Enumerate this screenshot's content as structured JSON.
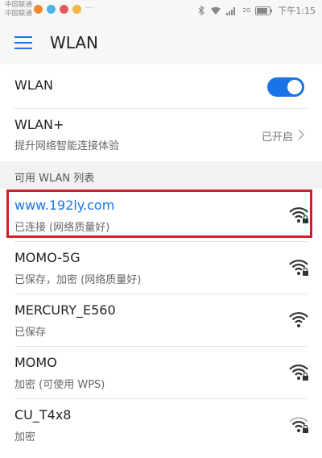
{
  "status_bar": {
    "carrier_1": "中国联通",
    "carrier_2": "中国联通",
    "more": "···",
    "signal_label": "2G",
    "time": "下午1:15"
  },
  "header": {
    "title": "WLAN"
  },
  "wlan_toggle": {
    "label": "WLAN",
    "state": "on"
  },
  "wlan_plus": {
    "label": "WLAN+",
    "subtitle": "提升网络智能连接体验",
    "status": "已开启"
  },
  "section": {
    "title": "可用 WLAN 列表"
  },
  "networks": [
    {
      "ssid": "www.192ly.com",
      "status": "已连接 (网络质量好)",
      "secured": true,
      "connected": true,
      "strength": 4
    },
    {
      "ssid": "MOMO-5G",
      "status": "已保存，加密 (网络质量好)",
      "secured": true,
      "connected": false,
      "strength": 4
    },
    {
      "ssid": "MERCURY_E560",
      "status": "已保存",
      "secured": false,
      "connected": false,
      "strength": 4
    },
    {
      "ssid": "MOMO",
      "status": "加密 (可使用 WPS)",
      "secured": true,
      "connected": false,
      "strength": 4
    },
    {
      "ssid": "CU_T4x8",
      "status": "加密",
      "secured": true,
      "connected": false,
      "strength": 3
    }
  ],
  "colors": {
    "accent": "#1a73e8",
    "highlight_border": "#d11f2a"
  },
  "icons": [
    "menu-icon",
    "wifi-signal-icon",
    "lock-icon",
    "chevron-right-icon",
    "bluetooth-icon",
    "battery-icon"
  ]
}
